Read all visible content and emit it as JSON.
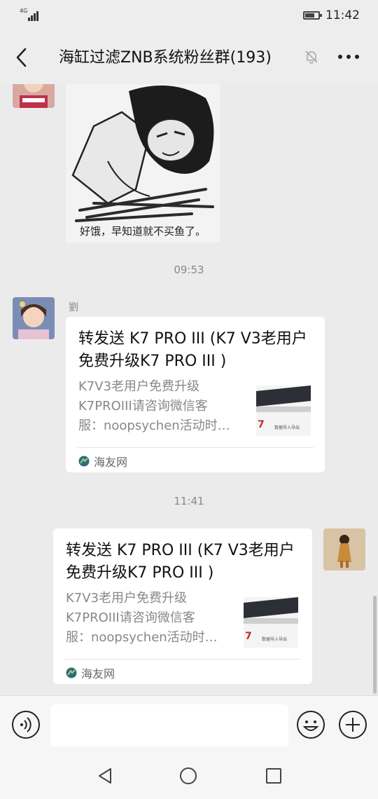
{
  "status_bar": {
    "network": "4G",
    "time": "11:42",
    "battery_level": 0.7
  },
  "header": {
    "title": "海缸过滤ZNB系统粉丝群(193)"
  },
  "messages": [
    {
      "type": "sticker",
      "caption": "好饿，早知道就不买鱼了。"
    },
    {
      "type": "time",
      "text": "09:53"
    },
    {
      "type": "link_card",
      "sender": "劉",
      "title": "转发送 K7 PRO III (K7 V3老用户免费升级K7 PRO III )",
      "desc": "K7V3老用户免费升级\nK7PROIII请咨询微信客\n服：noopsychen活动时…",
      "thumb_text_1": "7",
      "thumb_text_2": "数据导入导出",
      "source": "海友网"
    },
    {
      "type": "time",
      "text": "11:41"
    },
    {
      "type": "link_card_self",
      "title": "转发送 K7 PRO III (K7 V3老用户免费升级K7 PRO III )",
      "desc": "K7V3老用户免费升级\nK7PROIII请咨询微信客\n服：noopsychen活动时…",
      "thumb_text_1": "7",
      "thumb_text_2": "数据导入导出",
      "source": "海友网"
    }
  ],
  "input": {
    "placeholder": ""
  },
  "colors": {
    "bg": "#ebebeb",
    "bar": "#ededed",
    "card": "#ffffff",
    "meta": "#888888"
  }
}
